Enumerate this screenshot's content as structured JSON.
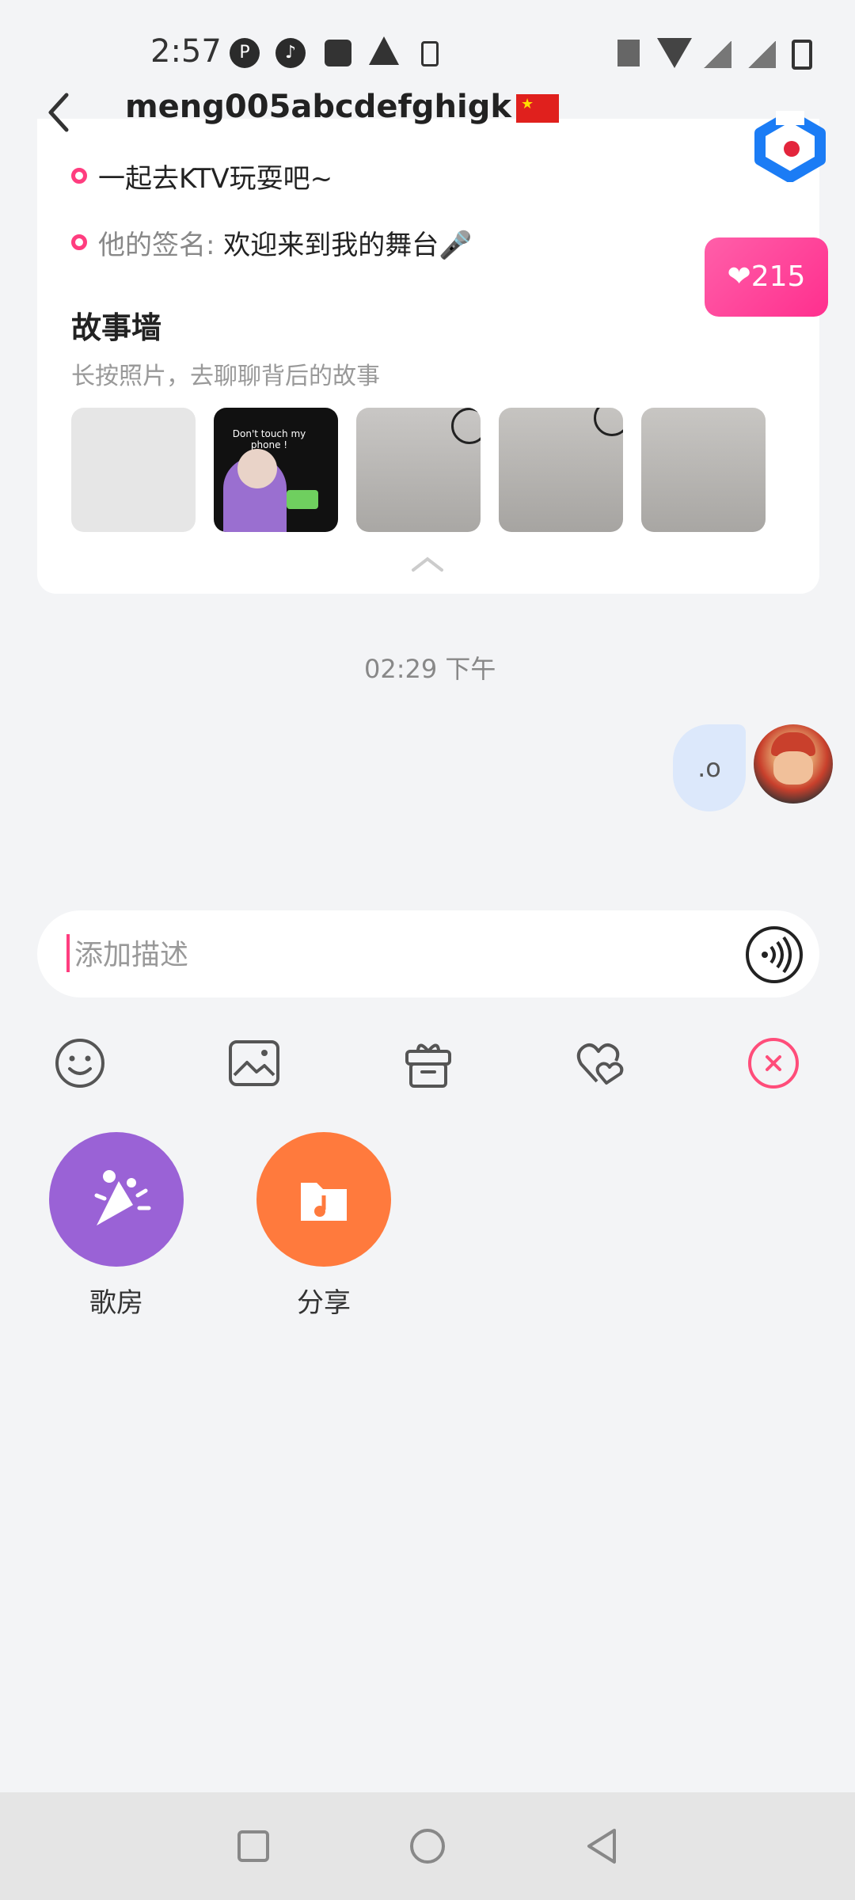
{
  "status": {
    "time": "2:57"
  },
  "header": {
    "title": "meng005abcdefghigk"
  },
  "profile": {
    "line1": "一起去KTV玩耍吧~",
    "signature_label": "他的签名:",
    "signature_text": " 欢迎来到我的舞台🎤",
    "hearts_count": "215"
  },
  "story_wall": {
    "title": "故事墙",
    "subtitle": "长按照片，去聊聊背后的故事",
    "meme_text": "Don't touch my phone !"
  },
  "chat": {
    "timestamp": "02:29 下午",
    "messages": [
      {
        "text": ".o",
        "from": "me"
      }
    ]
  },
  "input": {
    "placeholder": "添加描述"
  },
  "features": [
    {
      "label": "歌房",
      "color": "#9a62d6"
    },
    {
      "label": "分享",
      "color": "#ff7a3d"
    }
  ],
  "colors": {
    "accent": "#ff3d7f",
    "bubble": "#dce8fb"
  }
}
